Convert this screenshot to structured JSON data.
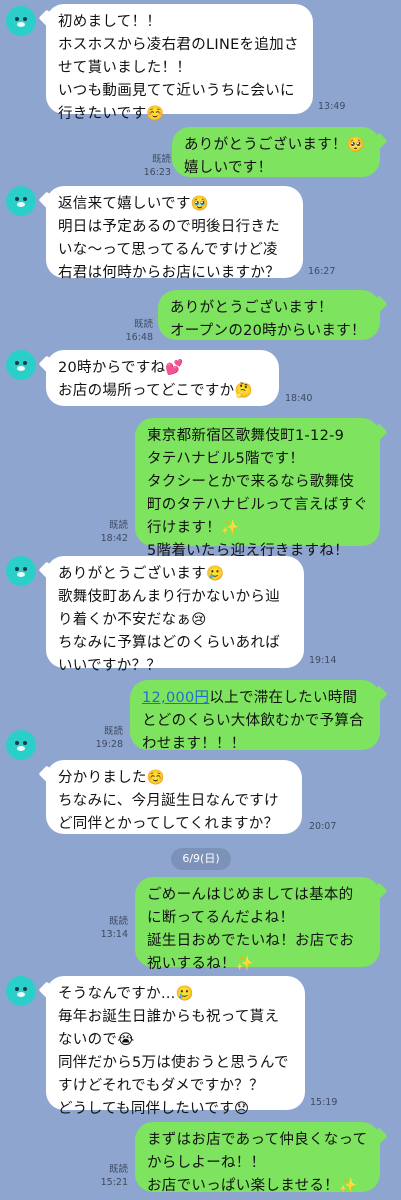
{
  "date_separator": "6/9(日)",
  "read_label": "既読",
  "messages": [
    {
      "side": "in",
      "text": "初めまして！！\nホスホスから凌右君のLINEを追加させて貰いました！！\nいつも動画見てて近いうちに会いに行きたいです☺️",
      "time": "13:49"
    },
    {
      "side": "out",
      "text": "ありがとうございます！🥺\n嬉しいです！",
      "time": "16:23"
    },
    {
      "side": "in",
      "text": "返信来て嬉しいです🥹\n明日は予定あるので明後日行きたいな〜って思ってるんですけど凌右君は何時からお店にいますか？",
      "time": "16:27"
    },
    {
      "side": "out",
      "text": "ありがとうございます！\nオープンの20時からいます！",
      "time": "16:48"
    },
    {
      "side": "in",
      "text": "20時からですね💕\nお店の場所ってどこですか🤔",
      "time": "18:40"
    },
    {
      "side": "out",
      "text": "東京都新宿区歌舞伎町1-12-9\nタテハナビル5階です！\nタクシーとかで来るなら歌舞伎町のタテハナビルって言えばすぐ行けます！✨\n5階着いたら迎え行きますね！",
      "time": "18:42"
    },
    {
      "side": "in",
      "text": "ありがとうございます🥲\n歌舞伎町あんまり行かないから辿り着くか不安だなぁ😢\nちなみに予算はどのくらいあればいいですか？？",
      "time": "19:14"
    },
    {
      "side": "out",
      "link": "12,000円",
      "text": "以上で滞在したい時間とどのくらい大体飲むかで予算合わせます！！！",
      "time": "19:28"
    },
    {
      "side": "in",
      "text": "分かりました☺️\nちなみに、今月誕生日なんですけど同伴とかってしてくれますか？",
      "time": "20:07"
    },
    {
      "side": "out",
      "text": "ごめーんはじめましては基本的に断ってるんだよね！\n誕生日おめでたいね！お店でお祝いするね！✨",
      "time": "13:14"
    },
    {
      "side": "in",
      "text": "そうなんですか…🥲\n毎年お誕生日誰からも祝って貰えないので😭\n同伴だから5万は使おうと思うんですけどそれでもダメですか？？\nどうしても同伴したいです😞",
      "time": "15:19"
    },
    {
      "side": "out",
      "text": "まずはお店であって仲良くなってからしよーね！！\nお店でいっぱい楽しませる！✨",
      "time": "15:21"
    }
  ]
}
